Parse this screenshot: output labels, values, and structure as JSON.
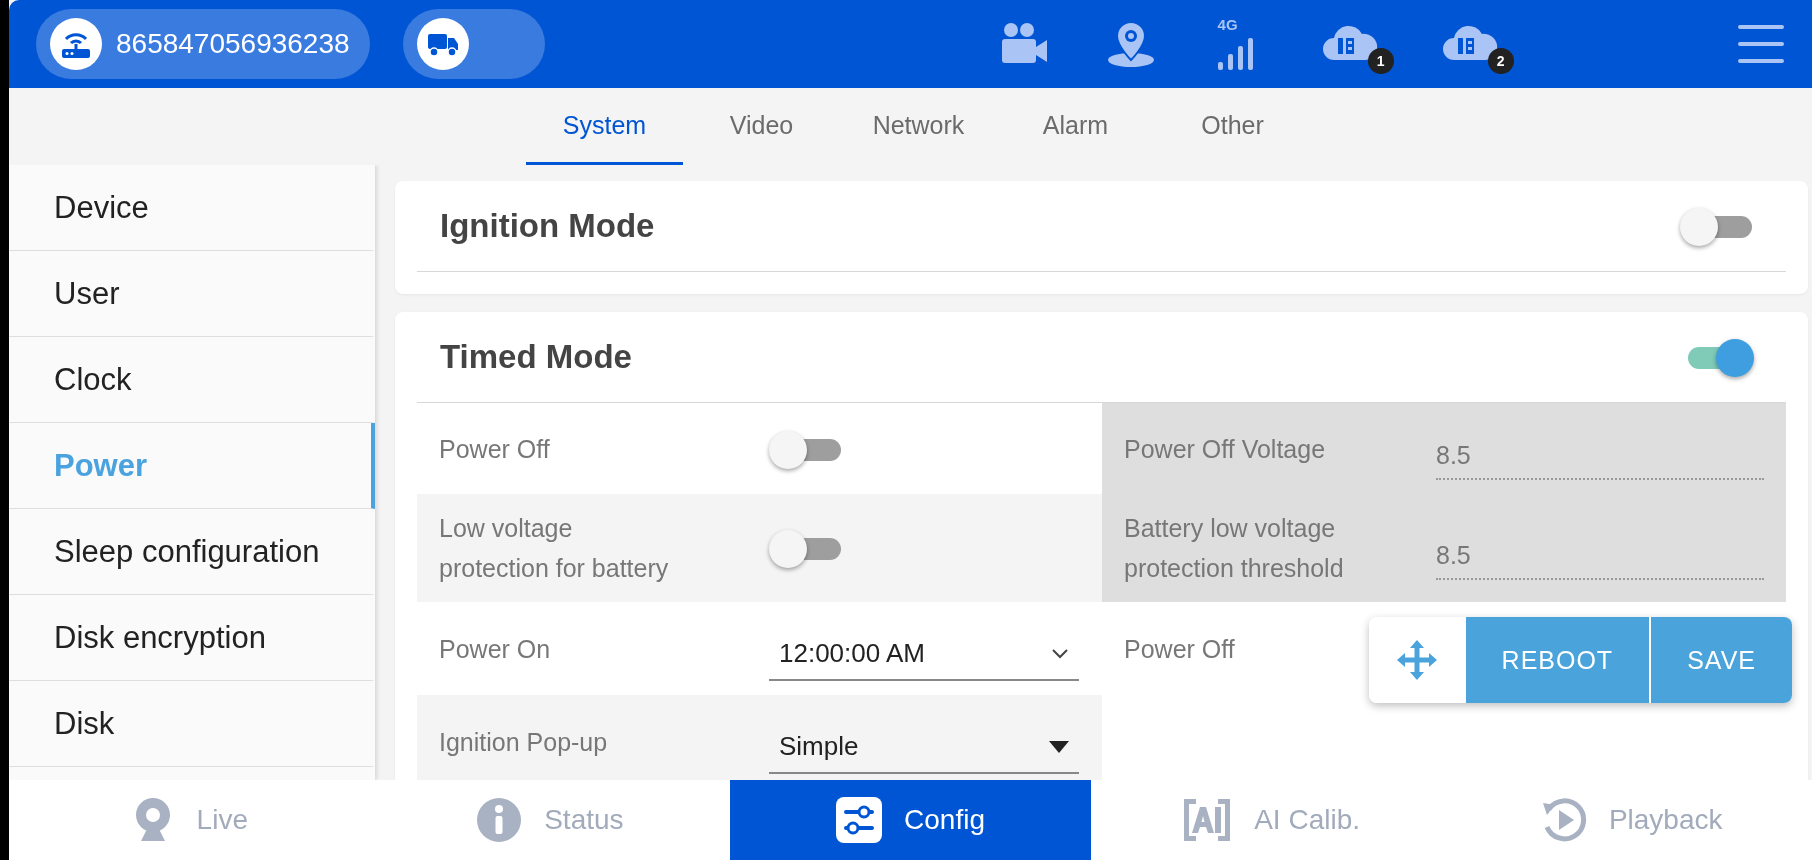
{
  "device_id": "865847056936238",
  "status_icons": [
    {
      "kind": "camera"
    },
    {
      "kind": "location"
    },
    {
      "kind": "signal",
      "label": "4G"
    },
    {
      "kind": "cloud",
      "badge": "1"
    },
    {
      "kind": "cloud",
      "badge": "2"
    }
  ],
  "tabs": [
    {
      "label": "System",
      "selected": true
    },
    {
      "label": "Video",
      "selected": false
    },
    {
      "label": "Network",
      "selected": false
    },
    {
      "label": "Alarm",
      "selected": false
    },
    {
      "label": "Other",
      "selected": false
    }
  ],
  "sidebar": {
    "items": [
      {
        "label": "Device",
        "selected": false
      },
      {
        "label": "User",
        "selected": false
      },
      {
        "label": "Clock",
        "selected": false
      },
      {
        "label": "Power",
        "selected": true
      },
      {
        "label": "Sleep configuration",
        "selected": false
      },
      {
        "label": "Disk encryption",
        "selected": false
      },
      {
        "label": "Disk",
        "selected": false
      }
    ]
  },
  "sections": [
    {
      "title": "Ignition Mode",
      "on": false
    },
    {
      "title": "Timed Mode",
      "on": true,
      "rows": [
        [
          {
            "kind": "toggle",
            "label": "Power Off",
            "on": false,
            "disabled": false
          },
          {
            "kind": "input",
            "label": "Power Off Voltage",
            "value": "8.5",
            "disabled": true
          }
        ],
        [
          {
            "kind": "toggle",
            "label": "Low voltage protection for battery",
            "on": false,
            "disabled": false
          },
          {
            "kind": "input",
            "label": "Battery low voltage protection threshold",
            "value": "8.5",
            "disabled": true
          }
        ],
        [
          {
            "kind": "time",
            "label": "Power On",
            "value": "12:00:00 AM",
            "disabled": false
          },
          {
            "kind": "label",
            "label": "Power Off",
            "disabled": false
          }
        ],
        [
          {
            "kind": "select",
            "label": "Ignition Pop-up",
            "value": "Simple",
            "disabled": false
          }
        ]
      ]
    }
  ],
  "actions": [
    {
      "label": "REBOOT"
    },
    {
      "label": "SAVE"
    }
  ],
  "bottom_nav": [
    {
      "kind": "live",
      "label": "Live",
      "selected": false
    },
    {
      "kind": "status",
      "label": "Status",
      "selected": false
    },
    {
      "kind": "config",
      "label": "Config",
      "selected": true
    },
    {
      "kind": "ai",
      "label": "AI Calib.",
      "selected": false
    },
    {
      "kind": "playback",
      "label": "Playback",
      "selected": false
    }
  ]
}
